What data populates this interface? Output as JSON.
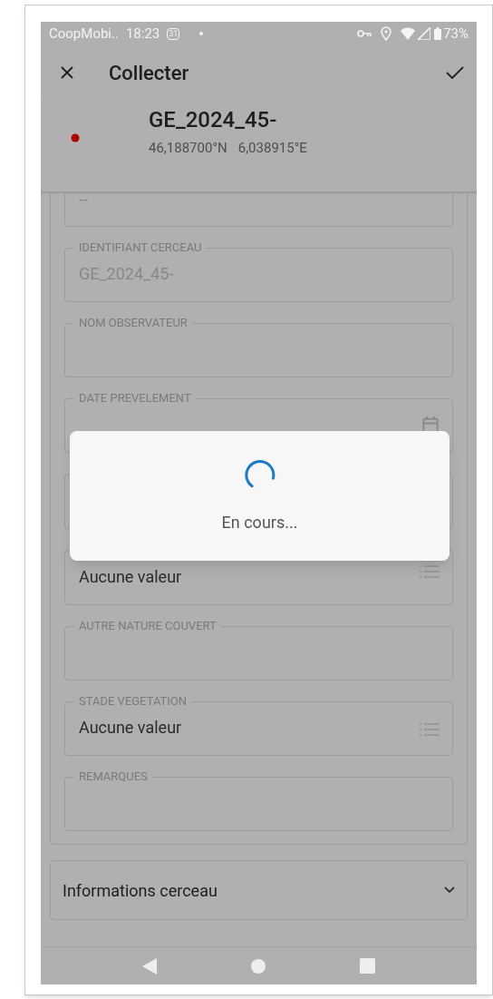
{
  "status_bar": {
    "app": "CoopMobi..",
    "time": "18:23",
    "calendar_day": "31",
    "battery": "73%"
  },
  "app_bar": {
    "title": "Collecter"
  },
  "header": {
    "title": "GE_2024_45-",
    "coordinates": [
      "46,188700°N",
      "6,038915°E"
    ],
    "color": "#b00000"
  },
  "fields": [
    {
      "kind": "text",
      "value": "--",
      "disabled": true,
      "cut": true
    },
    {
      "kind": "text",
      "label": "IDENTIFIANT CERCEAU",
      "value": "GE_2024_45-",
      "disabled": true
    },
    {
      "kind": "text",
      "label": "NOM OBSERVATEUR"
    },
    {
      "kind": "date",
      "label": "DATE PREVELEMENT"
    },
    {
      "kind": "text"
    },
    {
      "kind": "select",
      "value": "Aucune valeur",
      "disabled": false
    },
    {
      "kind": "text",
      "label": "AUTRE NATURE COUVERT"
    },
    {
      "kind": "select",
      "label": "STADE VEGETATION",
      "value": "Aucune valeur",
      "disabled": false
    },
    {
      "kind": "text",
      "label": "REMARQUES"
    }
  ],
  "accordion": {
    "title": "Informations cerceau",
    "expanded": false
  },
  "dialog": {
    "message": "En cours..."
  }
}
